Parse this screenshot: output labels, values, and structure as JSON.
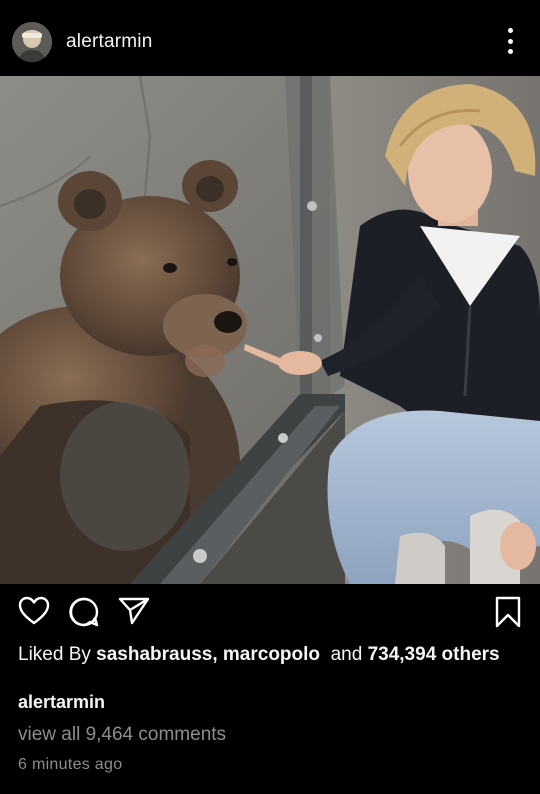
{
  "post": {
    "username": "alertarmin",
    "avatar_icon": "profile-avatar",
    "more_icon": "more-vertical-icon"
  },
  "photo": {
    "subject": "bear-and-man-at-glass-enclosure"
  },
  "actions": {
    "like_icon": "heart-icon",
    "comment_icon": "comment-bubble-icon",
    "share_icon": "paper-plane-icon",
    "save_icon": "bookmark-icon"
  },
  "likes": {
    "prefix": "Liked By",
    "names": "sashabrauss, marcopolo",
    "conjunction": "and",
    "count": "734,394",
    "suffix": "others"
  },
  "caption": {
    "username": "alertarmin"
  },
  "comments": {
    "link_text": "view all 9,464 comments"
  },
  "timestamp": "6 minutes ago"
}
